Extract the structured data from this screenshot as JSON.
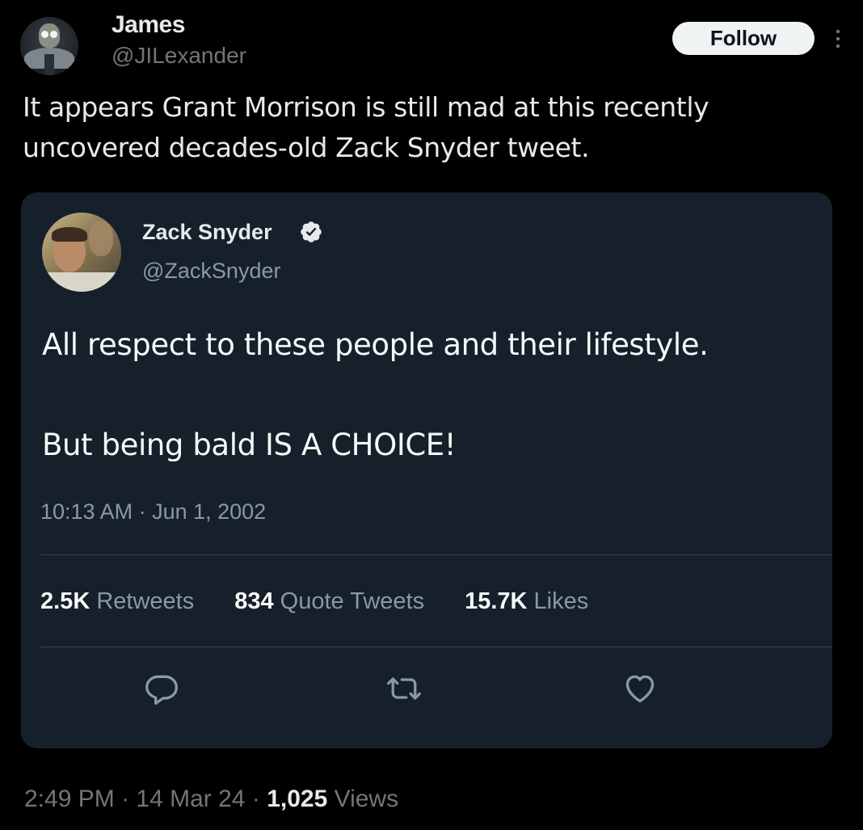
{
  "author": {
    "name": "James",
    "handle": "@JILexander",
    "follow_label": "Follow"
  },
  "tweet": {
    "text": "It appears Grant Morrison is still mad at this recently\nuncovered decades-old Zack Snyder tweet."
  },
  "quoted": {
    "name": "Zack Snyder",
    "handle": "@ZackSnyder",
    "text": "All respect to these people and their lifestyle.\n\nBut being bald IS A CHOICE!",
    "timestamp": "10:13 AM · Jun 1, 2002",
    "stats": {
      "retweets_count": "2.5K",
      "retweets_label": "Retweets",
      "quotes_count": "834",
      "quotes_label": "Quote Tweets",
      "likes_count": "15.7K",
      "likes_label": "Likes"
    },
    "actions": [
      "reply-icon",
      "retweet-icon",
      "like-icon"
    ]
  },
  "footer": {
    "time": "2:49 PM",
    "date": "14 Mar 24",
    "views_count": "1,025",
    "views_label": "Views"
  },
  "colors": {
    "background": "#000000",
    "card": "#15202b",
    "verified": "#e7e9ea",
    "muted": "#71767b"
  }
}
